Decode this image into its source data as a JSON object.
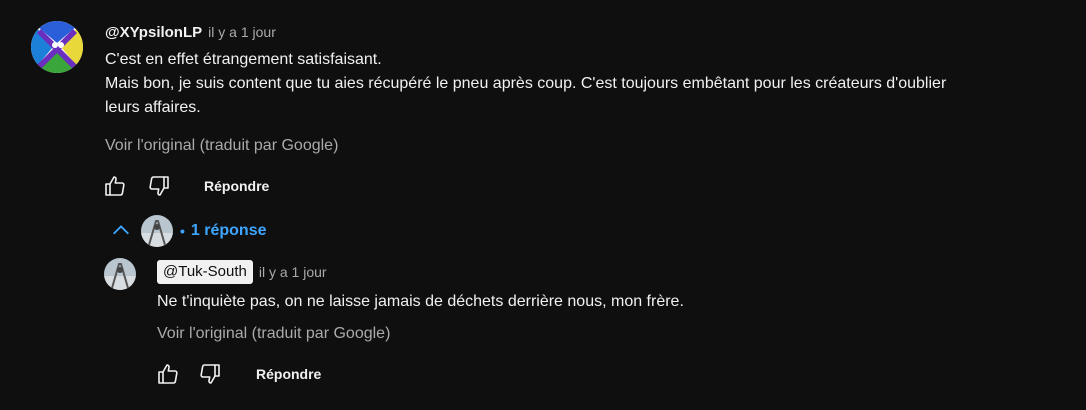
{
  "comment": {
    "author": "@XYpsilonLP",
    "time": "il y a 1 jour",
    "lines": [
      "C'est en effet étrangement satisfaisant.",
      "Mais bon, je suis content que tu aies récupéré le pneu après coup. C'est toujours embêtant pour les créateurs d'oublier",
      "leurs affaires."
    ],
    "see_original": "Voir l'original (traduit par Google)",
    "reply_label": "Répondre",
    "icons": {
      "like": "thumbs-up-icon",
      "dislike": "thumbs-down-icon"
    }
  },
  "replies_toggle": {
    "dot": "•",
    "label": "1 réponse",
    "icon": "chevron-up-icon",
    "color": "#3ea6ff"
  },
  "reply": {
    "author": "@Tuk-South",
    "time": "il y a 1 jour",
    "text": "Ne t'inquiète pas, on ne laisse jamais de déchets derrière nous, mon frère.",
    "see_original": "Voir l'original (traduit par Google)",
    "reply_label": "Répondre"
  },
  "colors": {
    "background": "#0f0f0f",
    "text": "#f1f1f1",
    "muted": "#aaaaaa",
    "accent": "#3ea6ff"
  }
}
